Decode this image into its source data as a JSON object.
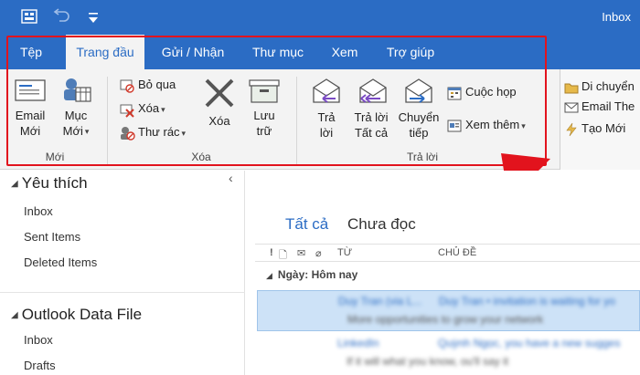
{
  "titlebar": {
    "app_title": "Inbox",
    "icons": [
      "send-receive-icon",
      "undo-icon",
      "customize-qat-icon"
    ],
    "color": "#2b6cc4"
  },
  "tabs": [
    {
      "label": "Tệp"
    },
    {
      "label": "Trang đầu",
      "active": true
    },
    {
      "label": "Gửi / Nhận"
    },
    {
      "label": "Thư mục"
    },
    {
      "label": "Xem"
    },
    {
      "label": "Trợ giúp"
    }
  ],
  "ribbon": {
    "new_group": {
      "label": "Mới",
      "email_new_line1": "Email",
      "email_new_line2": "Mới",
      "items_new_line1": "Mục",
      "items_new_line2": "Mới"
    },
    "delete_group": {
      "label": "Xóa",
      "ignore": "Bỏ qua",
      "cleanup": "Xóa",
      "junk": "Thư rác",
      "delete": "Xóa",
      "archive_line1": "Lưu",
      "archive_line2": "trữ"
    },
    "respond_group": {
      "label": "Trả lời",
      "reply_line1": "Trả",
      "reply_line2": "lời",
      "reply_all_line1": "Trả lời",
      "reply_all_line2": "Tất cả",
      "forward_line1": "Chuyển",
      "forward_line2": "tiếp",
      "meeting": "Cuộc họp",
      "more": "Xem thêm"
    },
    "quick_steps": {
      "move_to": "Di chuyển",
      "email_team": "Email The",
      "create_new": "Tạo Mới"
    }
  },
  "folders": {
    "favorites_label": "Yêu thích",
    "favorites": [
      "Inbox",
      "Sent Items",
      "Deleted Items"
    ],
    "datafile_label": "Outlook Data File",
    "datafile_items": [
      "Inbox",
      "Drafts"
    ]
  },
  "messages": {
    "tab_all": "Tất cả",
    "tab_unread": "Chưa đọc",
    "col_from": "TỪ",
    "col_subject": "CHỦ ĐỀ",
    "date_group": "Ngày: Hôm nay",
    "rows": [
      {
        "from": "Duy Tran (via L...",
        "subject": "Duy Tran • invitation is waiting for yo",
        "preview": "More opportunities to grow your network",
        "selected": true
      },
      {
        "from": "LinkedIn",
        "subject": "Quỳnh Ngọc, you have a new sugges",
        "preview": "If it will what you know, ou'll say it",
        "selected": false
      }
    ]
  },
  "accent_colors": {
    "brand": "#2b6cc4",
    "highlight": "#e2131d",
    "selection": "#cde2f7"
  }
}
